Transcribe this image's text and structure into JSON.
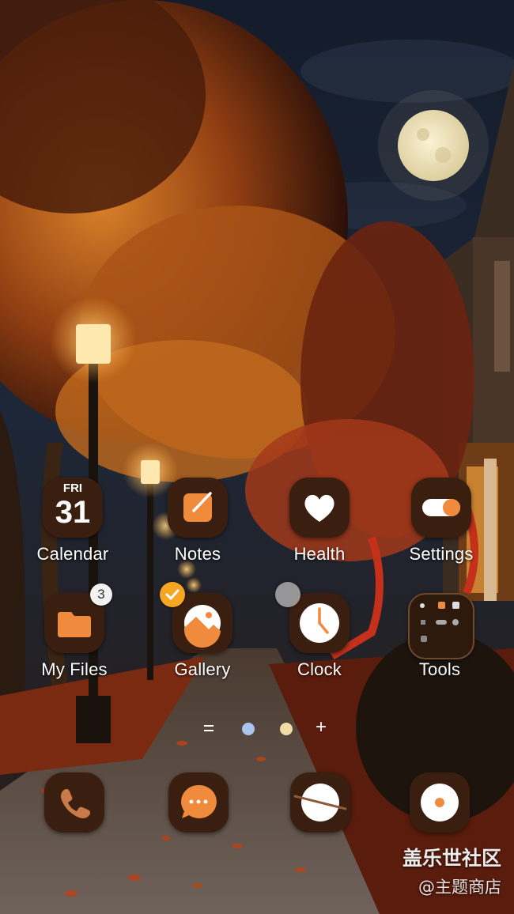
{
  "colors": {
    "icon_bg": "#3a1f10",
    "accent_orange": "#f08a3c",
    "label": "#ffffff",
    "badge_bg": "#f2f2f2"
  },
  "home_grid": {
    "row1": [
      {
        "label": "Calendar",
        "icon": "calendar-icon",
        "day": "FRI",
        "date": "31"
      },
      {
        "label": "Notes",
        "icon": "notes-icon"
      },
      {
        "label": "Health",
        "icon": "heart-icon"
      },
      {
        "label": "Settings",
        "icon": "toggle-icon"
      }
    ],
    "row2": [
      {
        "label": "My Files",
        "icon": "folder-icon",
        "badge": "3"
      },
      {
        "label": "Gallery",
        "icon": "gallery-icon"
      },
      {
        "label": "Clock",
        "icon": "clock-icon"
      },
      {
        "label": "Tools",
        "icon": "tools-folder-icon"
      }
    ]
  },
  "page_indicator": {
    "items": [
      "menu-lines-icon",
      "page-dot-1",
      "page-dot-2",
      "add-page-icon"
    ],
    "add_symbol": "+"
  },
  "dock": [
    {
      "icon": "phone-icon"
    },
    {
      "icon": "messages-icon"
    },
    {
      "icon": "internet-icon"
    },
    {
      "icon": "camera-icon"
    }
  ],
  "watermark": {
    "title": "盖乐世社区",
    "subtitle": "@主题商店"
  }
}
